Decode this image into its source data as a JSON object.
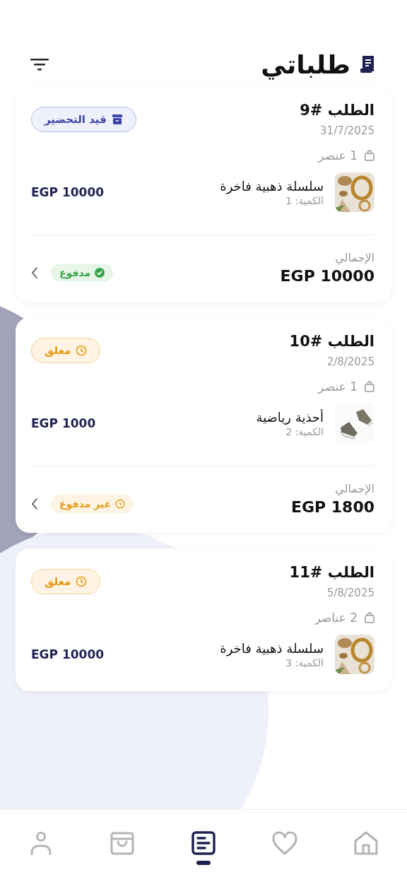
{
  "header": {
    "title": "طلباتي"
  },
  "orders": [
    {
      "title": "الطلب #9",
      "date": "31/7/2025",
      "status": {
        "kind": "preparing",
        "label": "قيد التحضير"
      },
      "item_count": "1 عنصر",
      "items": [
        {
          "kind": "jewelry",
          "name": "سلسلة ذهبية فاخرة",
          "quantity": "الكمية: 1",
          "price": "EGP 10000"
        }
      ],
      "total_label": "الإجمالي",
      "total": "EGP 10000",
      "payment": {
        "kind": "paid",
        "label": "مدفوع"
      }
    },
    {
      "title": "الطلب #10",
      "date": "2/8/2025",
      "status": {
        "kind": "pending",
        "label": "معلق"
      },
      "item_count": "1 عنصر",
      "items": [
        {
          "kind": "shoes",
          "name": "أحذية رياضية",
          "quantity": "الكمية: 2",
          "price": "EGP 1000"
        }
      ],
      "total_label": "الإجمالي",
      "total": "EGP 1800",
      "payment": {
        "kind": "unpaid",
        "label": "غير مدفوع"
      }
    },
    {
      "title": "الطلب #11",
      "date": "5/8/2025",
      "status": {
        "kind": "pending",
        "label": "معلق"
      },
      "item_count": "2 عناصر",
      "items": [
        {
          "kind": "jewelry",
          "name": "سلسلة ذهبية فاخرة",
          "quantity": "الكمية: 3",
          "price": "EGP 10000"
        }
      ]
    }
  ],
  "nav": [
    {
      "kind": "profile",
      "selected": false
    },
    {
      "kind": "cart",
      "selected": false
    },
    {
      "kind": "orders",
      "selected": true
    },
    {
      "kind": "favorites",
      "selected": false
    },
    {
      "kind": "home",
      "selected": false
    }
  ]
}
